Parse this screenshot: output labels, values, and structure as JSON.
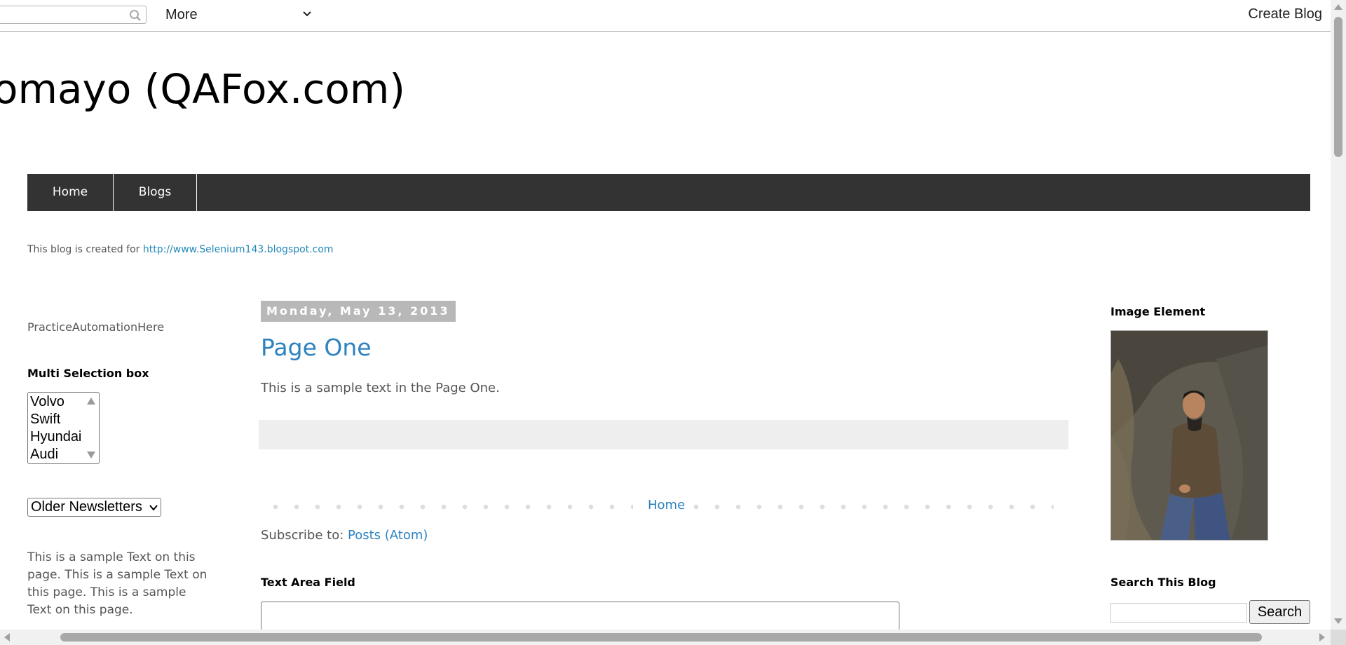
{
  "navbar": {
    "search_placeholder": "",
    "more_label": "More",
    "create_blog_label": "Create Blog"
  },
  "header": {
    "title": "omayo (QAFox.com)"
  },
  "tabs": [
    {
      "label": "Home"
    },
    {
      "label": "Blogs"
    }
  ],
  "description": {
    "prefix": "This blog is created for ",
    "link": "http://www.Selenium143.blogspot.com"
  },
  "left_sidebar": {
    "text1": "PracticeAutomationHere",
    "multiselect_heading": "Multi Selection box",
    "multiselect_options": [
      "Volvo",
      "Swift",
      "Hyundai",
      "Audi"
    ],
    "dropdown_selected": "Older Newsletters",
    "sample_text": "This is a sample Text on this page. This is a sample Text on this page. This is a sample Text on this page."
  },
  "main": {
    "date_header": "Monday, May 13, 2013",
    "post_title": "Page One",
    "post_body": "This is a sample text in the Page One.",
    "pager_home": "Home",
    "subscribe_prefix": "Subscribe to: ",
    "subscribe_link": "Posts (Atom)",
    "textarea_heading": "Text Area Field"
  },
  "right_sidebar": {
    "image_heading": "Image Element",
    "search_heading": "Search This Blog",
    "search_button": "Search"
  },
  "colors": {
    "tab_bar": "#333333",
    "link": "#2d82c0",
    "date_header_bg": "#b8b8b8"
  }
}
